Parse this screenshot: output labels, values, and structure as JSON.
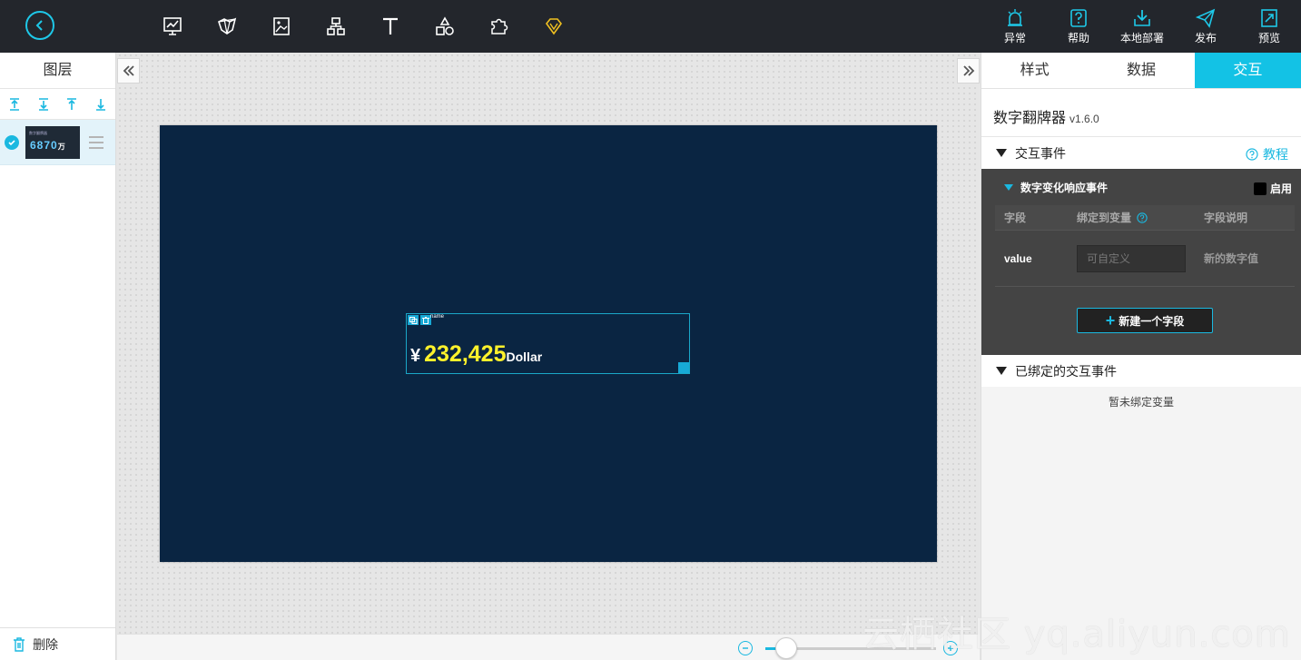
{
  "topbar": {
    "tools": [
      "chart-icon",
      "map-icon",
      "media-icon",
      "network-icon",
      "text-icon",
      "shapes-icon",
      "plugin-icon",
      "gem-icon"
    ],
    "right_buttons": [
      {
        "icon": "alarm-icon",
        "label": "异常"
      },
      {
        "icon": "help-icon",
        "label": "帮助"
      },
      {
        "icon": "download-icon",
        "label": "本地部署"
      },
      {
        "icon": "send-icon",
        "label": "发布"
      },
      {
        "icon": "preview-icon",
        "label": "预览"
      }
    ]
  },
  "layers": {
    "title": "图层",
    "items": [
      {
        "thumb_title": "数字翻牌器",
        "thumb_value": "6870",
        "thumb_unit": "万"
      }
    ],
    "delete_label": "删除"
  },
  "widget": {
    "name": "name",
    "currency": "¥",
    "value": "232,425",
    "unit": "Dollar"
  },
  "zoom": {
    "level": 0.12
  },
  "panel": {
    "tabs": [
      "样式",
      "数据",
      "交互"
    ],
    "active_tab": "交互",
    "component_name": "数字翻牌器",
    "component_version": "v1.6.0",
    "events_section": "交互事件",
    "tutorial_label": "教程",
    "event": {
      "title": "数字变化响应事件",
      "enable_label": "启用",
      "headers": [
        "字段",
        "绑定到变量",
        "字段说明"
      ],
      "rows": [
        {
          "field": "value",
          "placeholder": "可自定义",
          "desc": "新的数字值"
        }
      ],
      "new_field_label": "新建一个字段"
    },
    "bound_section": "已绑定的交互事件",
    "bound_empty": "暂未绑定变量"
  },
  "watermark": "云栖社区 yq.aliyun.com",
  "colors": {
    "accent": "#13c2e5",
    "screen_bg": "#0a2542",
    "value_yellow": "#fff22b",
    "topbar_bg": "#23262c"
  }
}
